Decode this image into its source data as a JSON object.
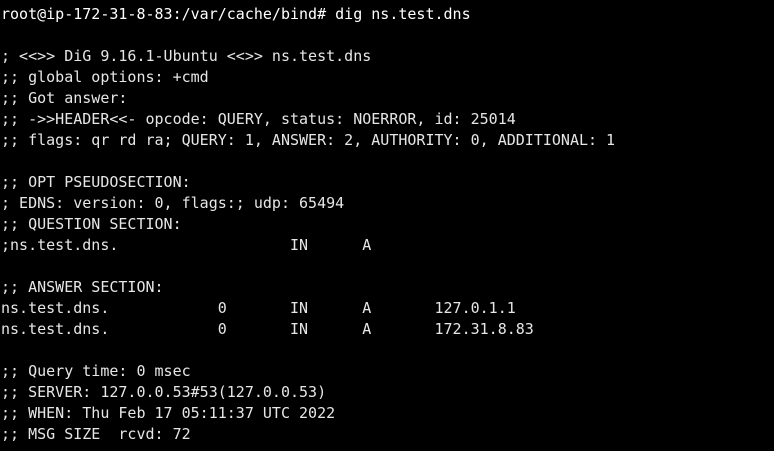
{
  "terminal": {
    "lines": [
      "root@ip-172-31-8-83:/var/cache/bind# dig ns.test.dns",
      "",
      "; <<>> DiG 9.16.1-Ubuntu <<>> ns.test.dns",
      ";; global options: +cmd",
      ";; Got answer:",
      ";; ->>HEADER<<- opcode: QUERY, status: NOERROR, id: 25014",
      ";; flags: qr rd ra; QUERY: 1, ANSWER: 2, AUTHORITY: 0, ADDITIONAL: 1",
      "",
      ";; OPT PSEUDOSECTION:",
      "; EDNS: version: 0, flags:; udp: 65494",
      ";; QUESTION SECTION:",
      ";ns.test.dns.                   IN      A",
      "",
      ";; ANSWER SECTION:",
      "ns.test.dns.            0       IN      A       127.0.1.1",
      "ns.test.dns.            0       IN      A       172.31.8.83",
      "",
      ";; Query time: 0 msec",
      ";; SERVER: 127.0.0.53#53(127.0.0.53)",
      ";; WHEN: Thu Feb 17 05:11:37 UTC 2022",
      ";; MSG SIZE  rcvd: 72"
    ]
  },
  "colors": {
    "background": "#000000",
    "text": "#e6e6e6"
  }
}
